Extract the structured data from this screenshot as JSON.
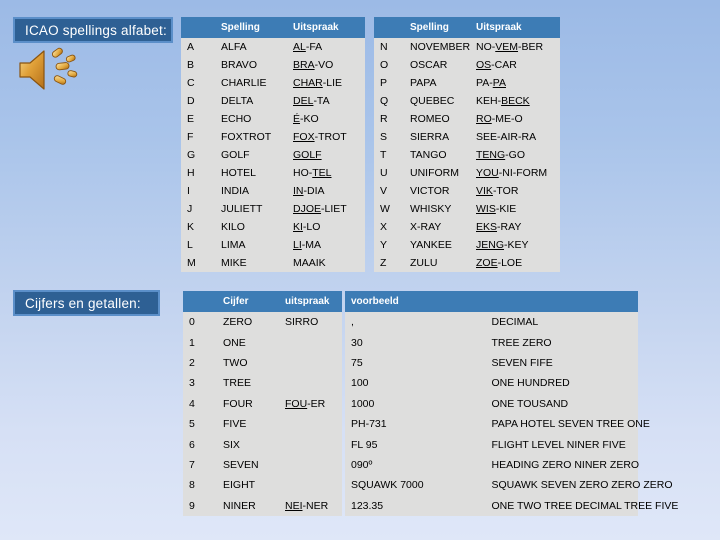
{
  "slide": {
    "background_top_color": "#9cbae6",
    "background_bottom_color": "#dfe7f8",
    "plate_fill_color": "#2e6094",
    "plate_border_color": "#5b8fc9",
    "table_header_color": "#3d7cb5",
    "table_body_color": "#dededd"
  },
  "titles": {
    "alphabet": "ICAO spellings alfabet:",
    "numbers": "Cijfers en getallen:"
  },
  "icons": {
    "speaker": "speaker-sound-icon"
  },
  "alphabet_table": {
    "headers": {
      "letter": "",
      "spelling": "Spelling",
      "pronunciation": "Uitspraak"
    },
    "left_rows": [
      {
        "letter": "A",
        "spelling": "ALFA",
        "pron_pre": "",
        "pron_stress": "AL",
        "pron_post": "-FA"
      },
      {
        "letter": "B",
        "spelling": "BRAVO",
        "pron_pre": "",
        "pron_stress": "BRA",
        "pron_post": "-VO"
      },
      {
        "letter": "C",
        "spelling": "CHARLIE",
        "pron_pre": "",
        "pron_stress": "CHAR",
        "pron_post": "-LIE"
      },
      {
        "letter": "D",
        "spelling": "DELTA",
        "pron_pre": "",
        "pron_stress": "DEL",
        "pron_post": "-TA"
      },
      {
        "letter": "E",
        "spelling": "ECHO",
        "pron_pre": "",
        "pron_stress": "É",
        "pron_post": "-KO"
      },
      {
        "letter": "F",
        "spelling": "FOXTROT",
        "pron_pre": "",
        "pron_stress": "FOX",
        "pron_post": "-TROT"
      },
      {
        "letter": "G",
        "spelling": "GOLF",
        "pron_pre": "",
        "pron_stress": "GOLF",
        "pron_post": ""
      },
      {
        "letter": "H",
        "spelling": "HOTEL",
        "pron_pre": "HO-",
        "pron_stress": "TEL",
        "pron_post": ""
      },
      {
        "letter": "I",
        "spelling": "INDIA",
        "pron_pre": "",
        "pron_stress": "IN",
        "pron_post": "-DIA"
      },
      {
        "letter": "J",
        "spelling": "JULIETT",
        "pron_pre": "",
        "pron_stress": "DJOE",
        "pron_post": "-LIET"
      },
      {
        "letter": "K",
        "spelling": "KILO",
        "pron_pre": "",
        "pron_stress": "KI",
        "pron_post": "-LO"
      },
      {
        "letter": "L",
        "spelling": "LIMA",
        "pron_pre": "",
        "pron_stress": "LI",
        "pron_post": "-MA"
      },
      {
        "letter": "M",
        "spelling": "MIKE",
        "pron_pre": "MAAIK",
        "pron_stress": "",
        "pron_post": ""
      }
    ],
    "right_rows": [
      {
        "letter": "N",
        "spelling": "NOVEMBER",
        "pron_pre": "NO-",
        "pron_stress": "VEM",
        "pron_post": "-BER"
      },
      {
        "letter": "O",
        "spelling": "OSCAR",
        "pron_pre": "",
        "pron_stress": "OS",
        "pron_post": "-CAR"
      },
      {
        "letter": "P",
        "spelling": "PAPA",
        "pron_pre": "PA-",
        "pron_stress": "PA",
        "pron_post": ""
      },
      {
        "letter": "Q",
        "spelling": "QUEBEC",
        "pron_pre": "KEH-",
        "pron_stress": "BECK",
        "pron_post": ""
      },
      {
        "letter": "R",
        "spelling": "ROMEO",
        "pron_pre": "",
        "pron_stress": "RO",
        "pron_post": "-ME-O"
      },
      {
        "letter": "S",
        "spelling": "SIERRA",
        "pron_pre": "SEE-AIR-RA",
        "pron_stress": "",
        "pron_post": ""
      },
      {
        "letter": "T",
        "spelling": "TANGO",
        "pron_pre": "",
        "pron_stress": "TENG",
        "pron_post": "-GO"
      },
      {
        "letter": "U",
        "spelling": "UNIFORM",
        "pron_pre": "",
        "pron_stress": "YOU",
        "pron_post": "-NI-FORM"
      },
      {
        "letter": "V",
        "spelling": "VICTOR",
        "pron_pre": "",
        "pron_stress": "VIK",
        "pron_post": "-TOR"
      },
      {
        "letter": "W",
        "spelling": "WHISKY",
        "pron_pre": "",
        "pron_stress": "WIS",
        "pron_post": "-KIE"
      },
      {
        "letter": "X",
        "spelling": "X-RAY",
        "pron_pre": "",
        "pron_stress": "EKS",
        "pron_post": "-RAY"
      },
      {
        "letter": "Y",
        "spelling": "YANKEE",
        "pron_pre": "",
        "pron_stress": "JENG",
        "pron_post": "-KEY"
      },
      {
        "letter": "Z",
        "spelling": "ZULU",
        "pron_pre": "",
        "pron_stress": "ZOE",
        "pron_post": "-LOE"
      }
    ]
  },
  "digits_table": {
    "headers": {
      "digit": "Cijfer",
      "pronunciation": "uitspraak"
    },
    "rows": [
      {
        "digit": "0",
        "word": "ZERO",
        "pron_pre": "SIRRO",
        "pron_stress": "",
        "pron_post": ""
      },
      {
        "digit": "1",
        "word": "ONE",
        "pron_pre": "",
        "pron_stress": "",
        "pron_post": ""
      },
      {
        "digit": "2",
        "word": "TWO",
        "pron_pre": "",
        "pron_stress": "",
        "pron_post": ""
      },
      {
        "digit": "3",
        "word": "TREE",
        "pron_pre": "",
        "pron_stress": "",
        "pron_post": ""
      },
      {
        "digit": "4",
        "word": "FOUR",
        "pron_pre": "",
        "pron_stress": "FOU",
        "pron_post": "-ER"
      },
      {
        "digit": "5",
        "word": "FIVE",
        "pron_pre": "",
        "pron_stress": "",
        "pron_post": ""
      },
      {
        "digit": "6",
        "word": "SIX",
        "pron_pre": "",
        "pron_stress": "",
        "pron_post": ""
      },
      {
        "digit": "7",
        "word": "SEVEN",
        "pron_pre": "",
        "pron_stress": "",
        "pron_post": ""
      },
      {
        "digit": "8",
        "word": "EIGHT",
        "pron_pre": "",
        "pron_stress": "",
        "pron_post": ""
      },
      {
        "digit": "9",
        "word": "NINER",
        "pron_pre": "",
        "pron_stress": "NEI",
        "pron_post": "-NER"
      }
    ]
  },
  "examples_table": {
    "headers": {
      "example": "voorbeeld"
    },
    "rows": [
      {
        "code": ",",
        "text": "DECIMAL"
      },
      {
        "code": "30",
        "text": "TREE ZERO"
      },
      {
        "code": "75",
        "text": "SEVEN FIFE"
      },
      {
        "code": "100",
        "text": "ONE HUNDRED"
      },
      {
        "code": "1000",
        "text": "ONE TOUSAND"
      },
      {
        "code": "PH-731",
        "text": "PAPA HOTEL SEVEN TREE ONE"
      },
      {
        "code": "FL 95",
        "text": "FLIGHT LEVEL NINER FIVE"
      },
      {
        "code": "090º",
        "text": "HEADING ZERO NINER ZERO"
      },
      {
        "code": "SQUAWK 7000",
        "text": "SQUAWK SEVEN ZERO ZERO ZERO"
      },
      {
        "code": "123.35",
        "text": "ONE TWO TREE DECIMAL TREE FIVE"
      }
    ]
  }
}
